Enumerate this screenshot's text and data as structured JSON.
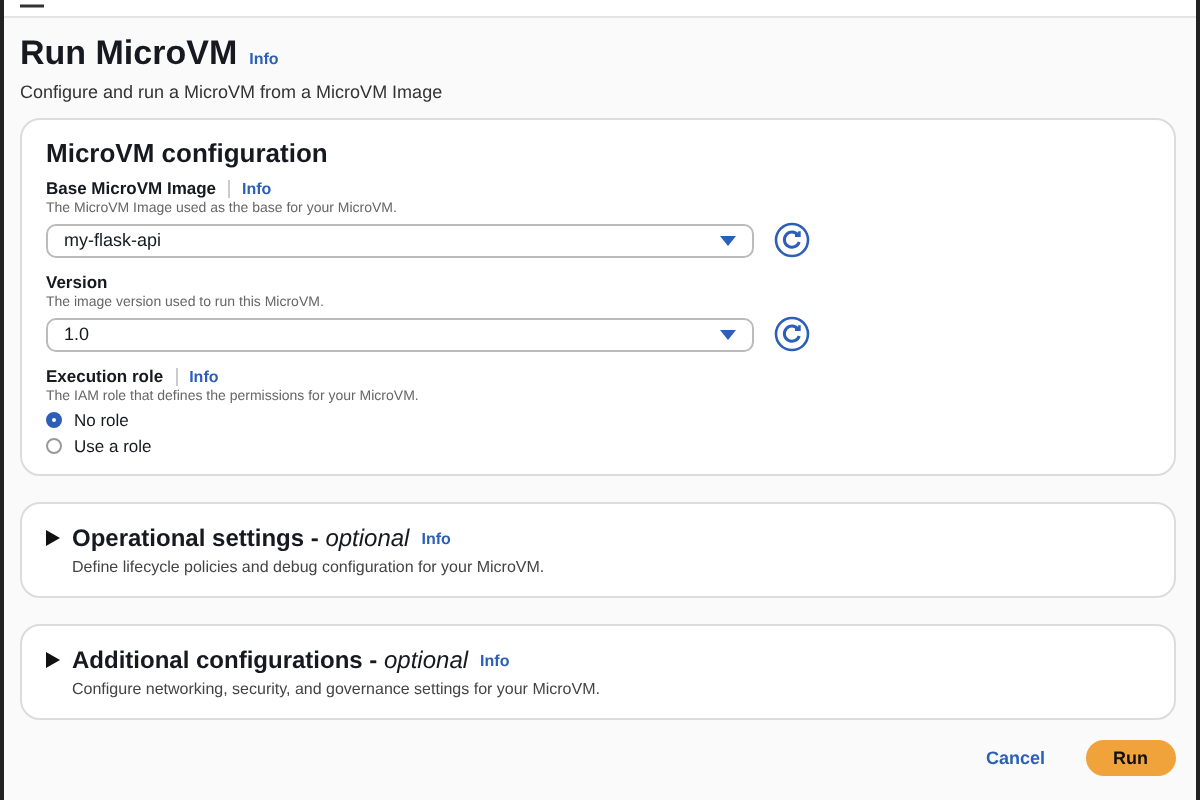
{
  "header": {
    "title": "Run MicroVM",
    "info": "Info",
    "description": "Configure and run a MicroVM from a MicroVM Image"
  },
  "configuration": {
    "title": "MicroVM configuration",
    "fields": [
      {
        "label": "Base MicroVM Image",
        "info": "Info",
        "description": "The MicroVM Image used as the base for your MicroVM.",
        "value": "my-flask-api"
      },
      {
        "label": "Version",
        "description": "The image version used to run this MicroVM.",
        "value": "1.0"
      }
    ],
    "execution_role": {
      "label": "Execution role",
      "info": "Info",
      "description": "The IAM role that defines the permissions for your MicroVM.",
      "options": [
        {
          "label": "No role",
          "selected": true
        },
        {
          "label": "Use a role",
          "selected": false
        }
      ]
    }
  },
  "sections": [
    {
      "title": "Operational settings - ",
      "optional": "optional",
      "info": "Info",
      "description": "Define lifecycle policies and debug configuration for your MicroVM.",
      "expanded": false
    },
    {
      "title": "Additional configurations - ",
      "optional": "optional",
      "info": "Info",
      "description": "Configure networking, security, and governance settings for your MicroVM.",
      "expanded": false
    }
  ],
  "buttons": {
    "cancel": "Cancel",
    "run": "Run"
  }
}
